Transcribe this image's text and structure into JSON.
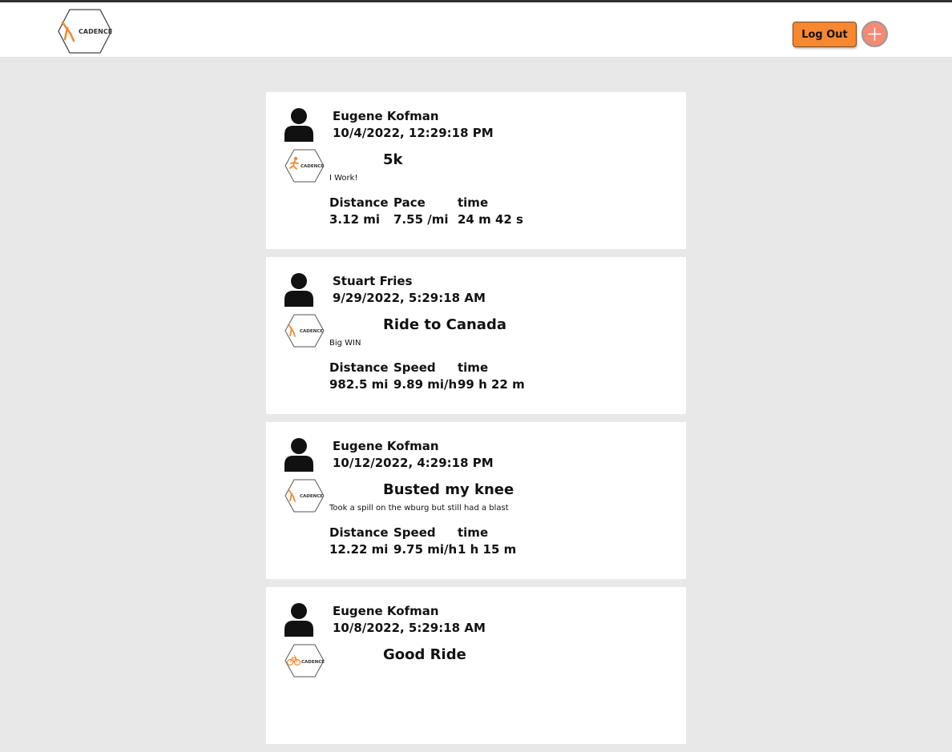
{
  "colors": {
    "accent": "#f7882f",
    "add_button": "#f48a74",
    "background": "#e8e8e8",
    "card": "#ffffff"
  },
  "header": {
    "logo_text": "CADENCE",
    "logout_label": "Log Out",
    "add_icon": "plus-icon"
  },
  "posts": [
    {
      "user": "Eugene Kofman",
      "date": "10/4/2022, 12:29:18 PM",
      "activity_icon": "runner-icon",
      "title": "5k",
      "description": "I Work!",
      "stats": [
        {
          "label": "Distance",
          "value": "3.12 mi"
        },
        {
          "label": "Pace",
          "value": "7.55 /mi"
        },
        {
          "label": "time",
          "value": "24 m 42 s"
        }
      ]
    },
    {
      "user": "Stuart Fries",
      "date": "9/29/2022, 5:29:18 AM",
      "activity_icon": "cadence-logo-icon",
      "title": "Ride to Canada",
      "description": "Big WIN",
      "stats": [
        {
          "label": "Distance",
          "value": "982.5 mi"
        },
        {
          "label": "Speed",
          "value": "9.89 mi/h"
        },
        {
          "label": "time",
          "value": "99 h 22 m"
        }
      ]
    },
    {
      "user": "Eugene Kofman",
      "date": "10/12/2022, 4:29:18 PM",
      "activity_icon": "cadence-logo-icon",
      "title": "Busted my knee",
      "description": "Took a spill on the wburg but still had a blast",
      "stats": [
        {
          "label": "Distance",
          "value": "12.22 mi"
        },
        {
          "label": "Speed",
          "value": "9.75 mi/h"
        },
        {
          "label": "time",
          "value": "1 h 15 m"
        }
      ]
    },
    {
      "user": "Eugene Kofman",
      "date": "10/8/2022, 5:29:18 AM",
      "activity_icon": "bicycle-icon",
      "title": "Good Ride",
      "description": "",
      "stats": []
    }
  ]
}
